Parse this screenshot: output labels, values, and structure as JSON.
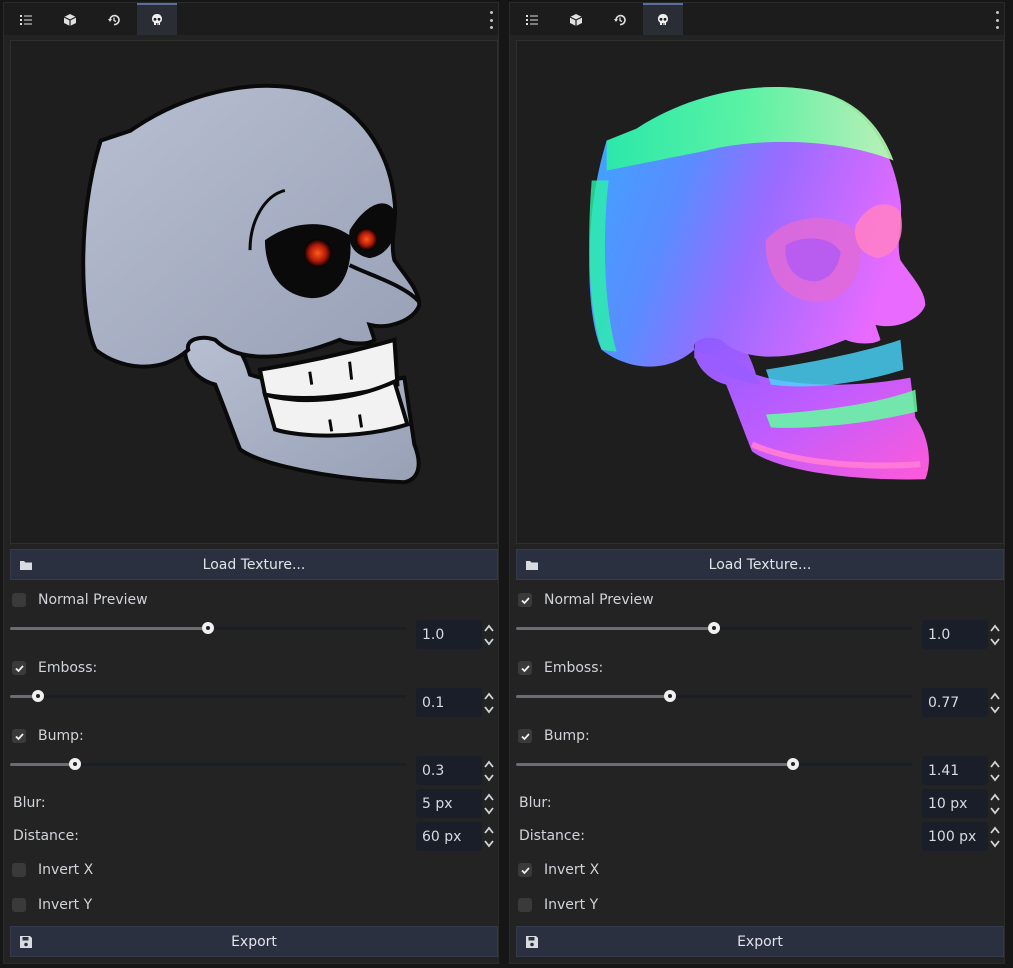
{
  "tabs": [
    {
      "icon": "list-icon"
    },
    {
      "icon": "cube-icon"
    },
    {
      "icon": "history-icon"
    },
    {
      "icon": "skull-icon",
      "active": true
    }
  ],
  "panels": [
    {
      "preview": "albedo-skull",
      "load_label": "Load Texture...",
      "normal_preview": {
        "label": "Normal Preview",
        "checked": false
      },
      "strength": {
        "value": "1.0",
        "fraction": 0.5
      },
      "emboss": {
        "label": "Emboss:",
        "checked": true,
        "value": "0.1",
        "fraction": 0.07
      },
      "bump": {
        "label": "Bump:",
        "checked": true,
        "value": "0.3",
        "fraction": 0.165
      },
      "blur": {
        "label": "Blur:",
        "value": "5 px"
      },
      "distance": {
        "label": "Distance:",
        "value": "60 px"
      },
      "invert_x": {
        "label": "Invert X",
        "checked": false
      },
      "invert_y": {
        "label": "Invert Y",
        "checked": false
      },
      "export_label": "Export"
    },
    {
      "preview": "normal-map-skull",
      "load_label": "Load Texture...",
      "normal_preview": {
        "label": "Normal Preview",
        "checked": true
      },
      "strength": {
        "value": "1.0",
        "fraction": 0.5
      },
      "emboss": {
        "label": "Emboss:",
        "checked": true,
        "value": "0.77",
        "fraction": 0.39
      },
      "bump": {
        "label": "Bump:",
        "checked": true,
        "value": "1.41",
        "fraction": 0.7
      },
      "blur": {
        "label": "Blur:",
        "value": "10 px"
      },
      "distance": {
        "label": "Distance:",
        "value": "100 px"
      },
      "invert_x": {
        "label": "Invert X",
        "checked": true
      },
      "invert_y": {
        "label": "Invert Y",
        "checked": false
      },
      "export_label": "Export"
    }
  ],
  "colors": {
    "accent": "#5a6fa0",
    "panel_bg": "#232323",
    "button_bg": "#2b3040",
    "field_bg": "#1a1e29"
  }
}
